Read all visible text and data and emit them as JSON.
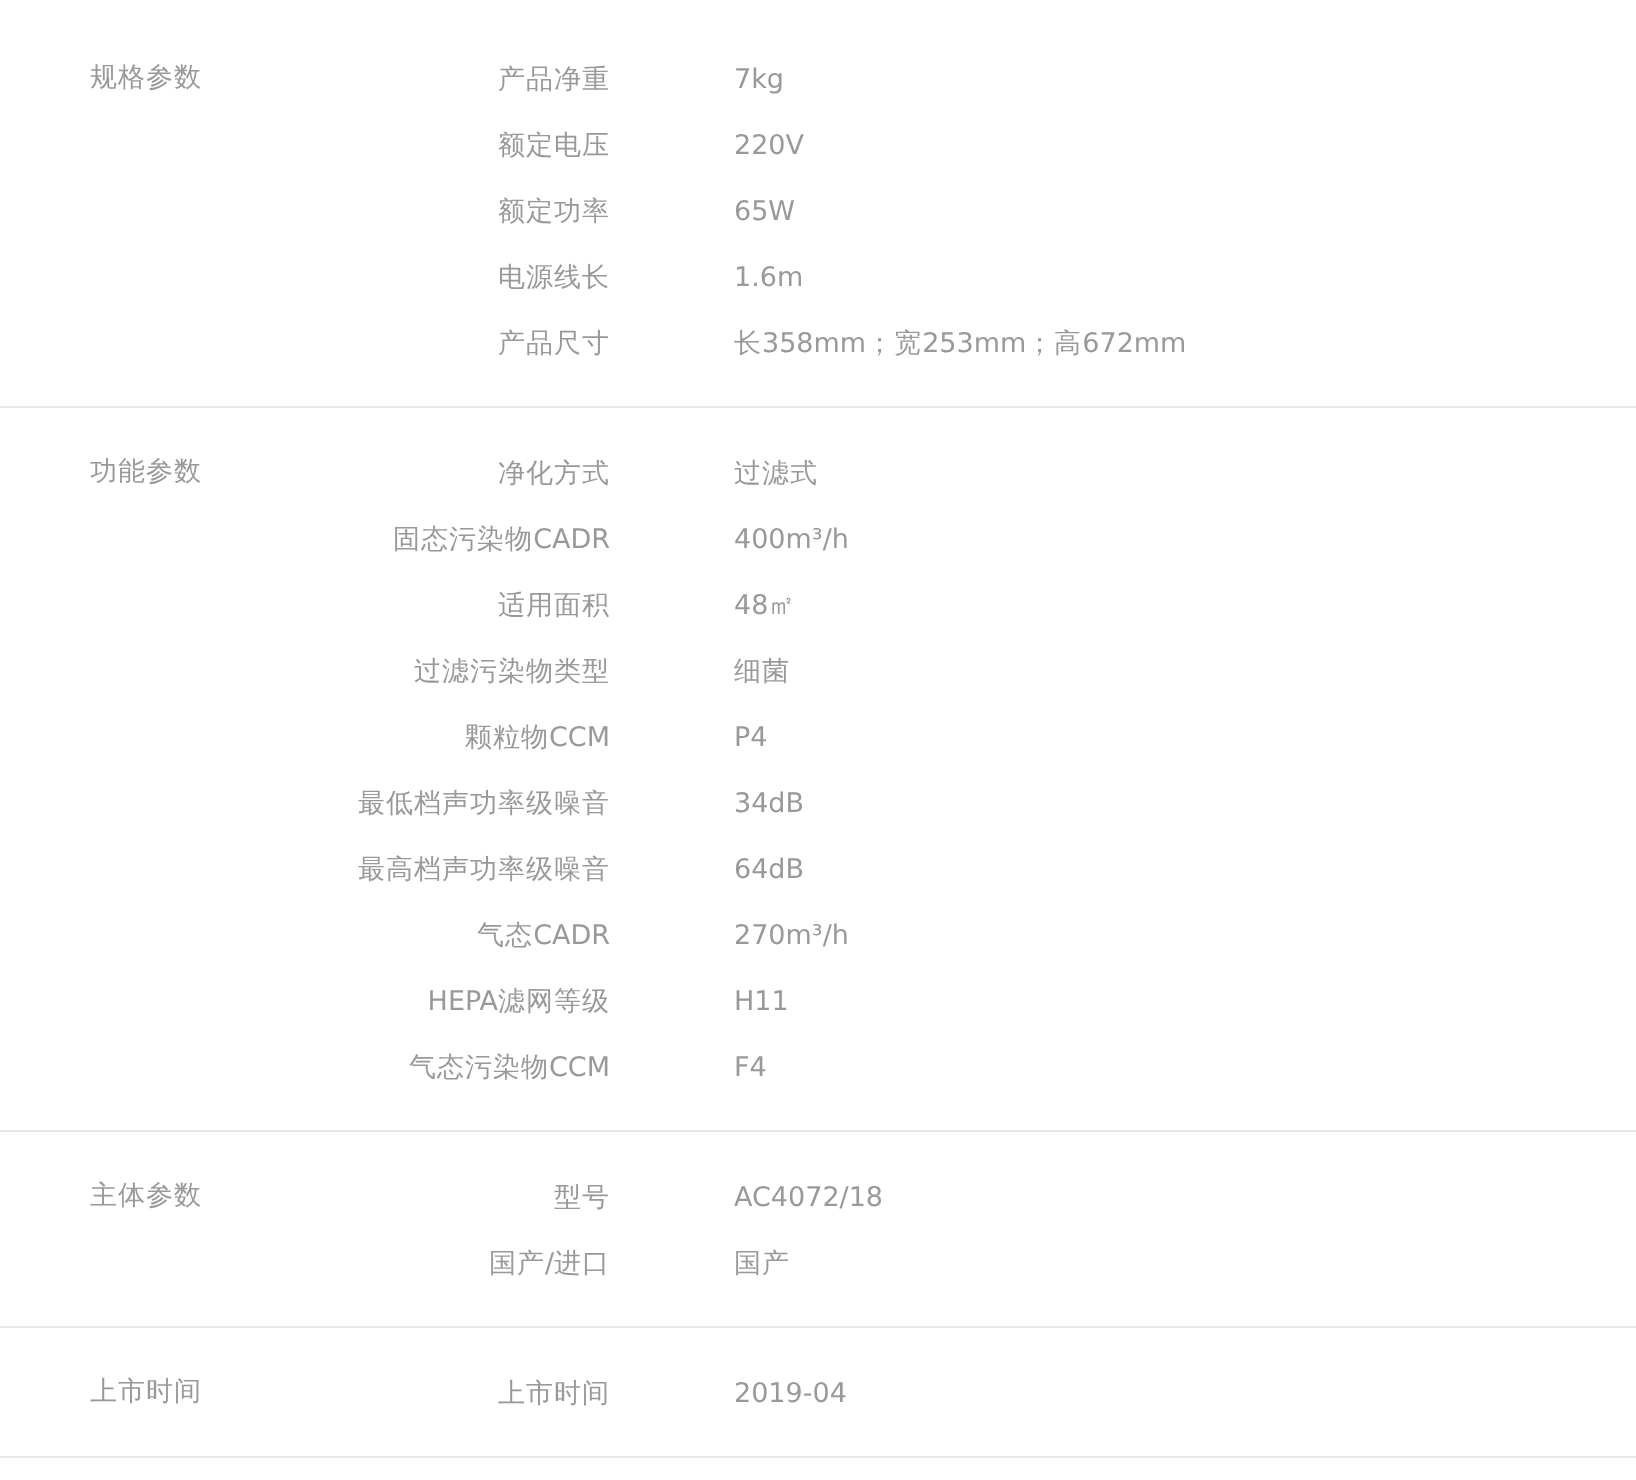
{
  "sections": [
    {
      "title": "规格参数",
      "rows": [
        {
          "label": "产品净重",
          "value": "7kg"
        },
        {
          "label": "额定电压",
          "value": "220V"
        },
        {
          "label": "额定功率",
          "value": "65W"
        },
        {
          "label": "电源线长",
          "value": "1.6m"
        },
        {
          "label": "产品尺寸",
          "value": "长358mm；宽253mm；高672mm"
        }
      ]
    },
    {
      "title": "功能参数",
      "rows": [
        {
          "label": "净化方式",
          "value": "过滤式"
        },
        {
          "label": "固态污染物CADR",
          "value": "400m³/h"
        },
        {
          "label": "适用面积",
          "value": "48㎡"
        },
        {
          "label": "过滤污染物类型",
          "value": "细菌"
        },
        {
          "label": "颗粒物CCM",
          "value": "P4"
        },
        {
          "label": "最低档声功率级噪音",
          "value": "34dB"
        },
        {
          "label": "最高档声功率级噪音",
          "value": "64dB"
        },
        {
          "label": "气态CADR",
          "value": "270m³/h"
        },
        {
          "label": "HEPA滤网等级",
          "value": "H11"
        },
        {
          "label": "气态污染物CCM",
          "value": "F4"
        }
      ]
    },
    {
      "title": "主体参数",
      "rows": [
        {
          "label": "型号",
          "value": "AC4072/18"
        },
        {
          "label": "国产/进口",
          "value": "国产"
        }
      ]
    },
    {
      "title": "上市时间",
      "rows": [
        {
          "label": "上市时间",
          "value": "2019-04"
        }
      ]
    }
  ]
}
